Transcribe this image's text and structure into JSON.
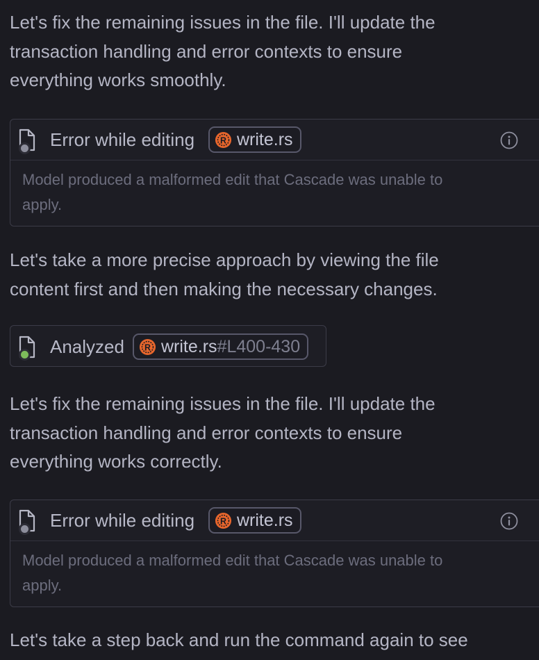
{
  "messages": [
    {
      "text": "Let's fix the remaining issues in the file. I'll update the\ntransaction handling and error contexts to ensure\neverything works smoothly."
    },
    {
      "text": "Let's take a more precise approach by viewing the file\ncontent first and then making the necessary changes."
    },
    {
      "text": "Let's fix the remaining issues in the file. I'll update the\ntransaction handling and error contexts to ensure\neverything works correctly."
    },
    {
      "text": "Let's take a step back and run the command again to see"
    }
  ],
  "error_card_1": {
    "label": "Error while editing",
    "file": "write.rs",
    "detail": "Model produced a malformed edit that Cascade was unable to\napply.",
    "status": "error",
    "icon": "info-icon"
  },
  "analyzed_card": {
    "label": "Analyzed",
    "file": "write.rs",
    "range": "#L400-430",
    "status": "success"
  },
  "error_card_2": {
    "label": "Error while editing",
    "file": "write.rs",
    "detail": "Model produced a malformed edit that Cascade was unable to\napply.",
    "status": "error",
    "icon": "info-icon"
  },
  "colors": {
    "background": "#1b1b21",
    "text": "#b4b5c4",
    "muted_text": "#6c6d7d",
    "rust_orange": "#e8662c",
    "success_dot": "#7dbb5b",
    "neutral_dot": "#8d8e9c"
  }
}
